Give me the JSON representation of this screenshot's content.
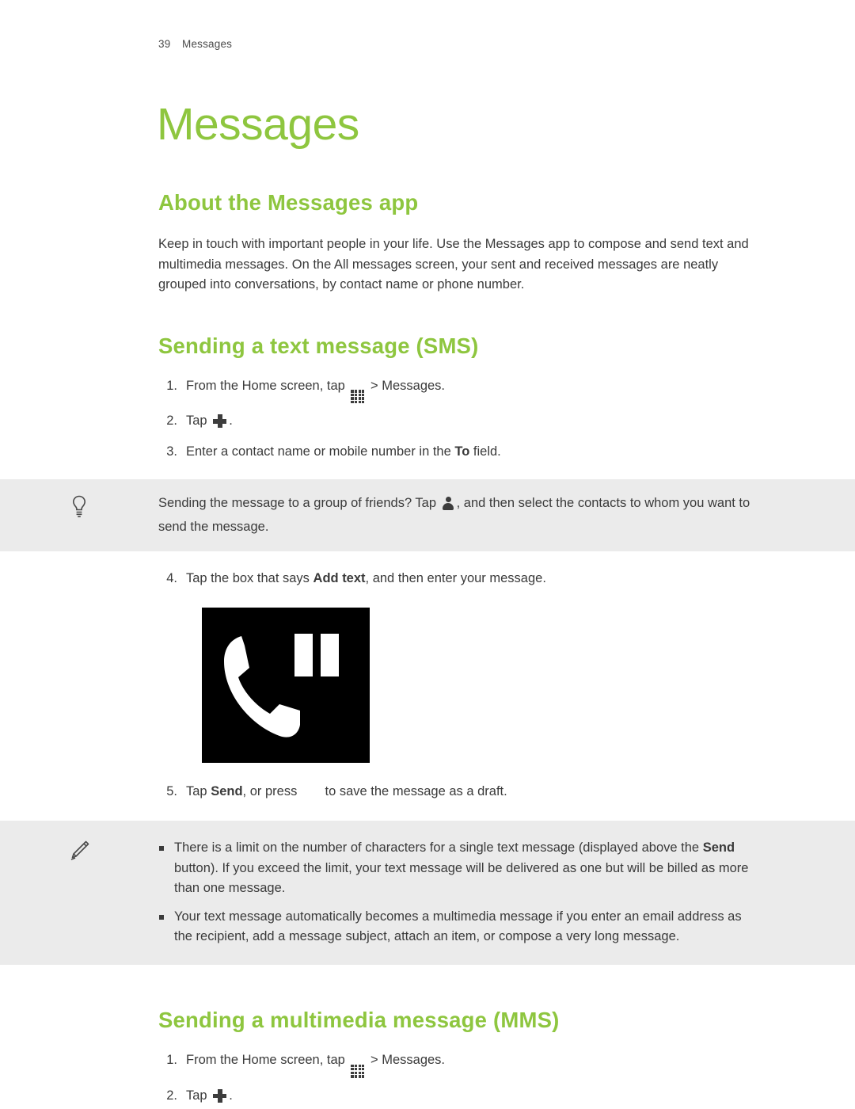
{
  "header": {
    "page_number": "39",
    "chapter": "Messages"
  },
  "title": "Messages",
  "sections": [
    {
      "heading": "About the Messages app",
      "paragraph": "Keep in touch with important people in your life. Use the Messages app to compose and send text and multimedia messages. On the All messages screen, your sent and received messages are neatly grouped into conversations, by contact name or phone number."
    },
    {
      "heading": "Sending a text message (SMS)"
    },
    {
      "heading": "Sending a multimedia message (MMS)"
    }
  ],
  "sms_steps": {
    "step1": {
      "num": "1.",
      "text_before": "From the Home screen, tap",
      "icon": "app-grid-icon",
      "text_after": "> Messages."
    },
    "step2": {
      "num": "2.",
      "text_before": "Tap",
      "icon": "plus-icon",
      "text_after": "."
    },
    "step3": {
      "num": "3.",
      "text_before": "Enter a contact name or mobile number in the",
      "bold": "To",
      "text_after": "field."
    },
    "step4": {
      "num": "4.",
      "text_before": "Tap the box that says",
      "bold": "Add text",
      "text_after": ", and then enter your message."
    },
    "step5": {
      "num": "5.",
      "text_before": "Tap",
      "bold": "Send",
      "text_mid": ", or press",
      "text_after": "to save the message as a draft."
    }
  },
  "tip_callout": {
    "icon": "lightbulb-icon",
    "text_before": "Sending the message to a group of friends? Tap",
    "inline_icon": "person-icon",
    "text_after": ", and then select the contacts to whom you want to send the message."
  },
  "note_callout": {
    "icon": "pencil-icon",
    "bullets": [
      {
        "part1": "There is a limit on the number of characters for a single text message (displayed above the",
        "bold": "Send",
        "part2": "button). If you exceed the limit, your text message will be delivered as one but will be billed as more than one message."
      },
      {
        "part1": "Your text message automatically becomes a multimedia message if you enter an email address as the recipient, add a message subject, attach an item, or compose a very long message.",
        "bold": "",
        "part2": ""
      }
    ]
  },
  "mms_steps": {
    "step1": {
      "num": "1.",
      "text_before": "From the Home screen, tap",
      "icon": "app-grid-icon",
      "text_after": "> Messages."
    },
    "step2": {
      "num": "2.",
      "text_before": "Tap",
      "icon": "plus-icon",
      "text_after": "."
    }
  },
  "screenshot": {
    "alt": "phone-handset-pause-icon"
  },
  "colors": {
    "accent_green": "#8ec63f",
    "callout_bg": "#ebebeb",
    "body_text": "#3a3a3a"
  }
}
